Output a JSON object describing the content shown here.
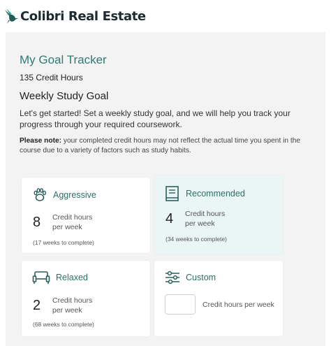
{
  "brand": {
    "name": "Colibri Real Estate"
  },
  "tracker": {
    "title": "My Goal Tracker",
    "credits": "135 Credit Hours",
    "section_title": "Weekly Study Goal",
    "intro": "Let's get started! Set a weekly study goal, and we will help you track your progress through your required coursework.",
    "note_label": "Please note:",
    "note_text": " your completed credit hours may not reflect the actual time you spent in the course due to a variety of factors such as study habits."
  },
  "options": [
    {
      "label": "Aggressive",
      "hours": "8",
      "unit_line1": "Credit hours",
      "unit_line2": "per week",
      "weeks": "(17 weeks to complete)",
      "icon": "paw-icon"
    },
    {
      "label": "Recommended",
      "hours": "4",
      "unit_line1": "Credit hours",
      "unit_line2": "per week",
      "weeks": "(34 weeks to complete)",
      "icon": "book-icon"
    },
    {
      "label": "Relaxed",
      "hours": "2",
      "unit_line1": "Credit hours",
      "unit_line2": "per week",
      "weeks": "(68 weeks to complete)",
      "icon": "couch-icon"
    },
    {
      "label": "Custom",
      "unit": "Credit hours per week",
      "input_value": "",
      "icon": "sliders-icon"
    }
  ],
  "colors": {
    "accent": "#2f7a72",
    "selected_bg": "#eaf5f5",
    "panel_bg": "#f3f3f3"
  }
}
